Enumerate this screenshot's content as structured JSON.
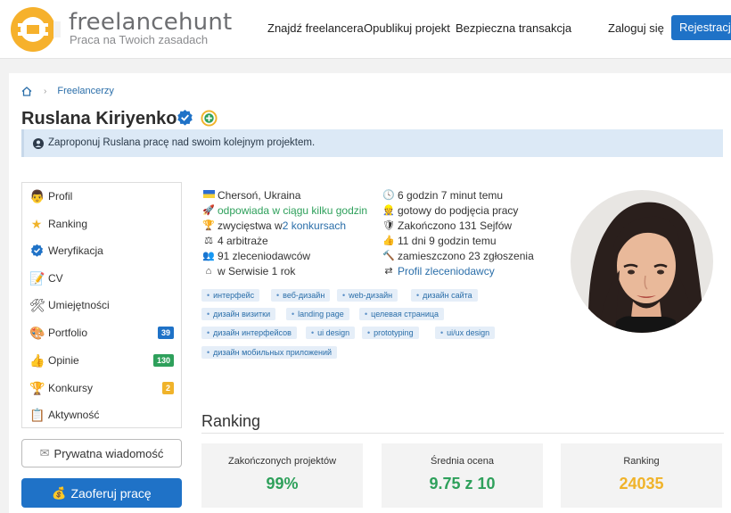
{
  "header": {
    "brand": "freelancehunt",
    "tagline": "Praca na Twoich zasadach",
    "nav": [
      "Znajdź freelancera",
      "Opublikuj projekt",
      "Bezpieczna transakcja"
    ],
    "login": "Zaloguj się",
    "register": "Rejestracja"
  },
  "breadcrumb": {
    "home_icon": "home-icon",
    "item": "Freelancerzy"
  },
  "profile": {
    "name": "Ruslana Kiriyenko",
    "notice": "Zaproponuj Ruslana pracę nad swoim kolejnym projektem."
  },
  "menu": [
    {
      "label": "Profil",
      "icon": "user-icon"
    },
    {
      "label": "Ranking",
      "icon": "star-icon"
    },
    {
      "label": "Weryfikacja",
      "icon": "verified-icon"
    },
    {
      "label": "CV",
      "icon": "document-icon"
    },
    {
      "label": "Umiejętności",
      "icon": "tools-icon"
    },
    {
      "label": "Portfolio",
      "icon": "palette-icon",
      "count": "39",
      "count_color": "#1f72c7"
    },
    {
      "label": "Opinie",
      "icon": "thumbs-up-icon",
      "count": "130",
      "count_color": "#2ea05b"
    },
    {
      "label": "Konkursy",
      "icon": "trophy-icon",
      "count": "2",
      "count_color": "#f0b32a"
    },
    {
      "label": "Aktywność",
      "icon": "clipboard-icon"
    }
  ],
  "buttons": {
    "message": "Prywatna wiadomość",
    "offer": "Zaoferuj pracę"
  },
  "info_left": {
    "location": "Chersoń, Ukraina",
    "responds": "odpowiada w ciągu kilku godzin",
    "wins_prefix": "zwycięstwa w ",
    "wins_link": "2 konkursach",
    "arbitration": "4 arbitraże",
    "clients": "91 zleceniodawców",
    "service": "w Serwisie 1 rok"
  },
  "info_right": {
    "last_seen": "6 godzin 7 minut temu",
    "ready": "gotowy do podjęcia pracy",
    "safes": "Zakończono 131 Sejfów",
    "days": "11 dni 9 godzin temu",
    "bids": "zamieszczono 23 zgłoszenia",
    "clients_profile": "Profil zleceniodawcy"
  },
  "tags": [
    [
      "интерфейс",
      "веб-дизайн",
      "web-дизайн",
      "дизайн сайта"
    ],
    [
      "дизайн визитки",
      "landing page",
      "целевая страница"
    ],
    [
      "дизайн интерфейсов",
      "ui design",
      "prototyping",
      "ui/ux design"
    ],
    [
      "дизайн мобильных приложений"
    ]
  ],
  "ranking": {
    "title": "Ranking",
    "stats": [
      {
        "label": "Zakończonych projektów",
        "value": "99%",
        "color": "#2ea05b"
      },
      {
        "label": "Średnia ocena",
        "value": "9.75 z 10",
        "color": "#2ea05b"
      },
      {
        "label": "Ranking",
        "value": "24035",
        "color": "#f0b32a"
      }
    ]
  }
}
